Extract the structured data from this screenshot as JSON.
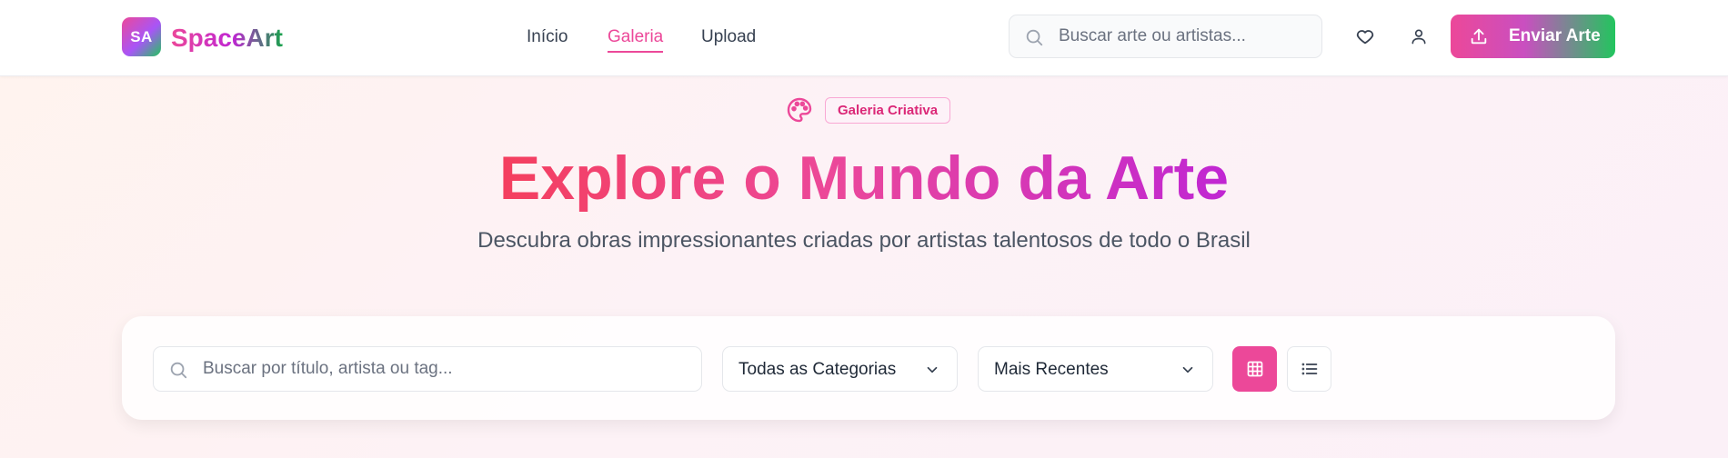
{
  "header": {
    "logo_initials": "SA",
    "brand": "SpaceArt",
    "nav": [
      {
        "label": "Início",
        "active": false
      },
      {
        "label": "Galeria",
        "active": true
      },
      {
        "label": "Upload",
        "active": false
      }
    ],
    "search_placeholder": "Buscar arte ou artistas...",
    "icons": [
      "search-icon",
      "heart-icon",
      "user-icon",
      "upload-icon"
    ],
    "send_button": "Enviar Arte"
  },
  "hero": {
    "badge": "Galeria Criativa",
    "icon": "palette-icon",
    "title": "Explore o Mundo da Arte",
    "subtitle": "Descubra obras impressionantes criadas por artistas talentosos de todo o Brasil"
  },
  "filters": {
    "search_placeholder": "Buscar por título, artista ou tag...",
    "category_value": "Todas as Categorias",
    "sort_value": "Mais Recentes",
    "view_modes": [
      {
        "name": "grid",
        "icon": "grid-icon",
        "active": true
      },
      {
        "name": "list",
        "icon": "list-icon",
        "active": false
      }
    ]
  },
  "colors": {
    "accent": "#ec4899",
    "brand_gradient_start": "#ec4899",
    "brand_gradient_end": "#22c55e",
    "title_gradient_start": "#f43f5e",
    "title_gradient_end": "#c026d3"
  }
}
